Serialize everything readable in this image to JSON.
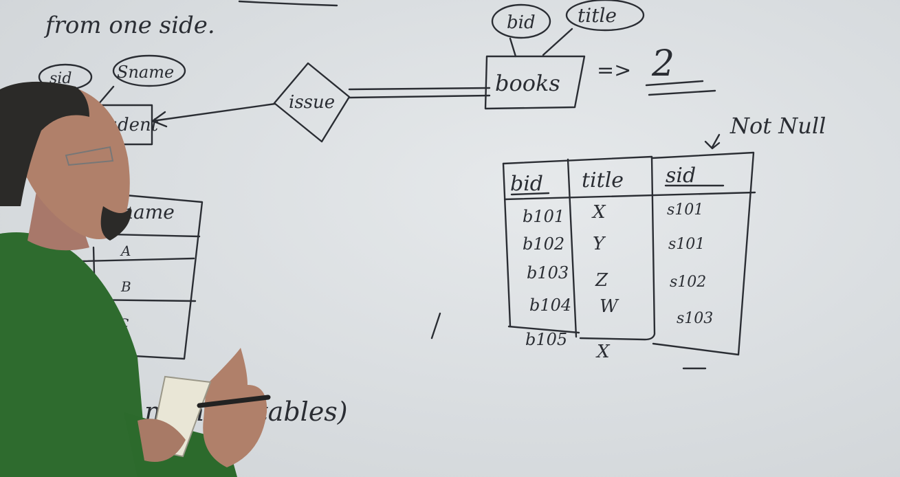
{
  "board": {
    "heading_fragment": "from one side.",
    "bottom_note": "m these tables)",
    "arrow_symbol": "=>",
    "result_value": "2",
    "not_null_note": "Not Null"
  },
  "entities": {
    "student": {
      "label": "Student",
      "attributes": [
        "sid",
        "Sname"
      ]
    },
    "books": {
      "label": "books",
      "attributes": [
        "bid",
        "title"
      ]
    },
    "relationship": {
      "label": "issue"
    }
  },
  "student_table": {
    "header": "name",
    "rows": [
      "A",
      "B",
      "C"
    ]
  },
  "books_table": {
    "columns": [
      "bid",
      "title",
      "sid"
    ],
    "rows": [
      [
        "b101",
        "X",
        "s101"
      ],
      [
        "b102",
        "Y",
        "s101"
      ],
      [
        "b103",
        "Z",
        "s102"
      ],
      [
        "b104",
        "W",
        "s103"
      ]
    ],
    "extra_row": [
      "b105",
      "X"
    ]
  },
  "colors": {
    "board": "#d9dde0",
    "ink": "#2a2d33",
    "shirt": "#2e6b2e",
    "skin": "#b0806a",
    "hair": "#2b2a28",
    "marker": "#e9e6d6"
  }
}
